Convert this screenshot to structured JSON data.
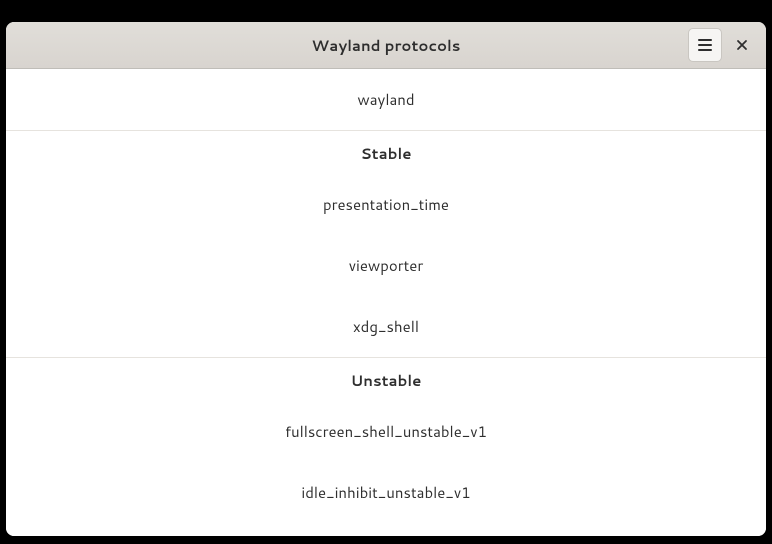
{
  "header": {
    "title": "Wayland protocols"
  },
  "sections": {
    "core": {
      "items": [
        "wayland"
      ]
    },
    "stable": {
      "title": "Stable",
      "items": [
        "presentation_time",
        "viewporter",
        "xdg_shell"
      ]
    },
    "unstable": {
      "title": "Unstable",
      "items": [
        "fullscreen_shell_unstable_v1",
        "idle_inhibit_unstable_v1"
      ]
    }
  }
}
